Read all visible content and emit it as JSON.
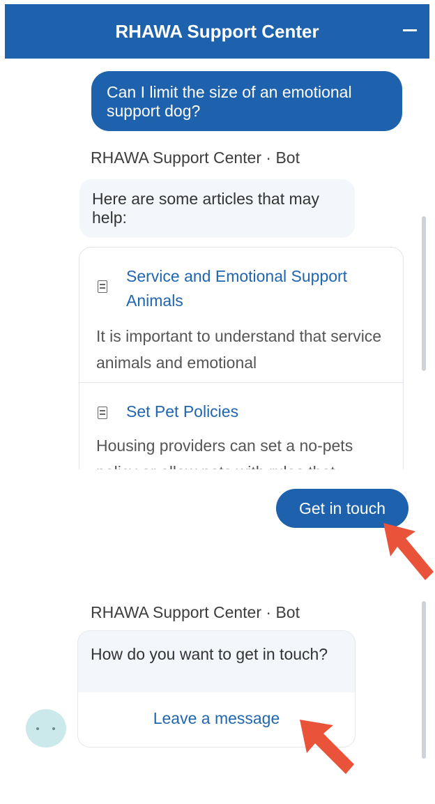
{
  "header": {
    "title": "RHAWA Support Center",
    "minimize_icon": "minimize-icon"
  },
  "conversation": {
    "user_message": "Can I limit the size of an emotional support dog?",
    "bot_sender_1": "RHAWA Support Center · Bot",
    "bot_message_1": "Here are some articles that may help:",
    "articles": [
      {
        "icon": "document-icon",
        "title": "Service and Emotional Support Animals",
        "snippet": "It is important to understand that service animals and emotional"
      },
      {
        "icon": "document-icon",
        "title": "Set Pet Policies",
        "snippet": "Housing providers can set a no-pets policy or allow pets with rules that"
      }
    ],
    "cta_button": "Get in touch",
    "bot_sender_2": "RHAWA Support Center · Bot",
    "bot_message_2": "How do you want to get in touch?",
    "option_label": "Leave a message"
  },
  "colors": {
    "brand_blue": "#1e62ad",
    "link_blue": "#1f65b0",
    "annotation_arrow": "#e8533a",
    "avatar_bg": "#cbe9eb"
  }
}
